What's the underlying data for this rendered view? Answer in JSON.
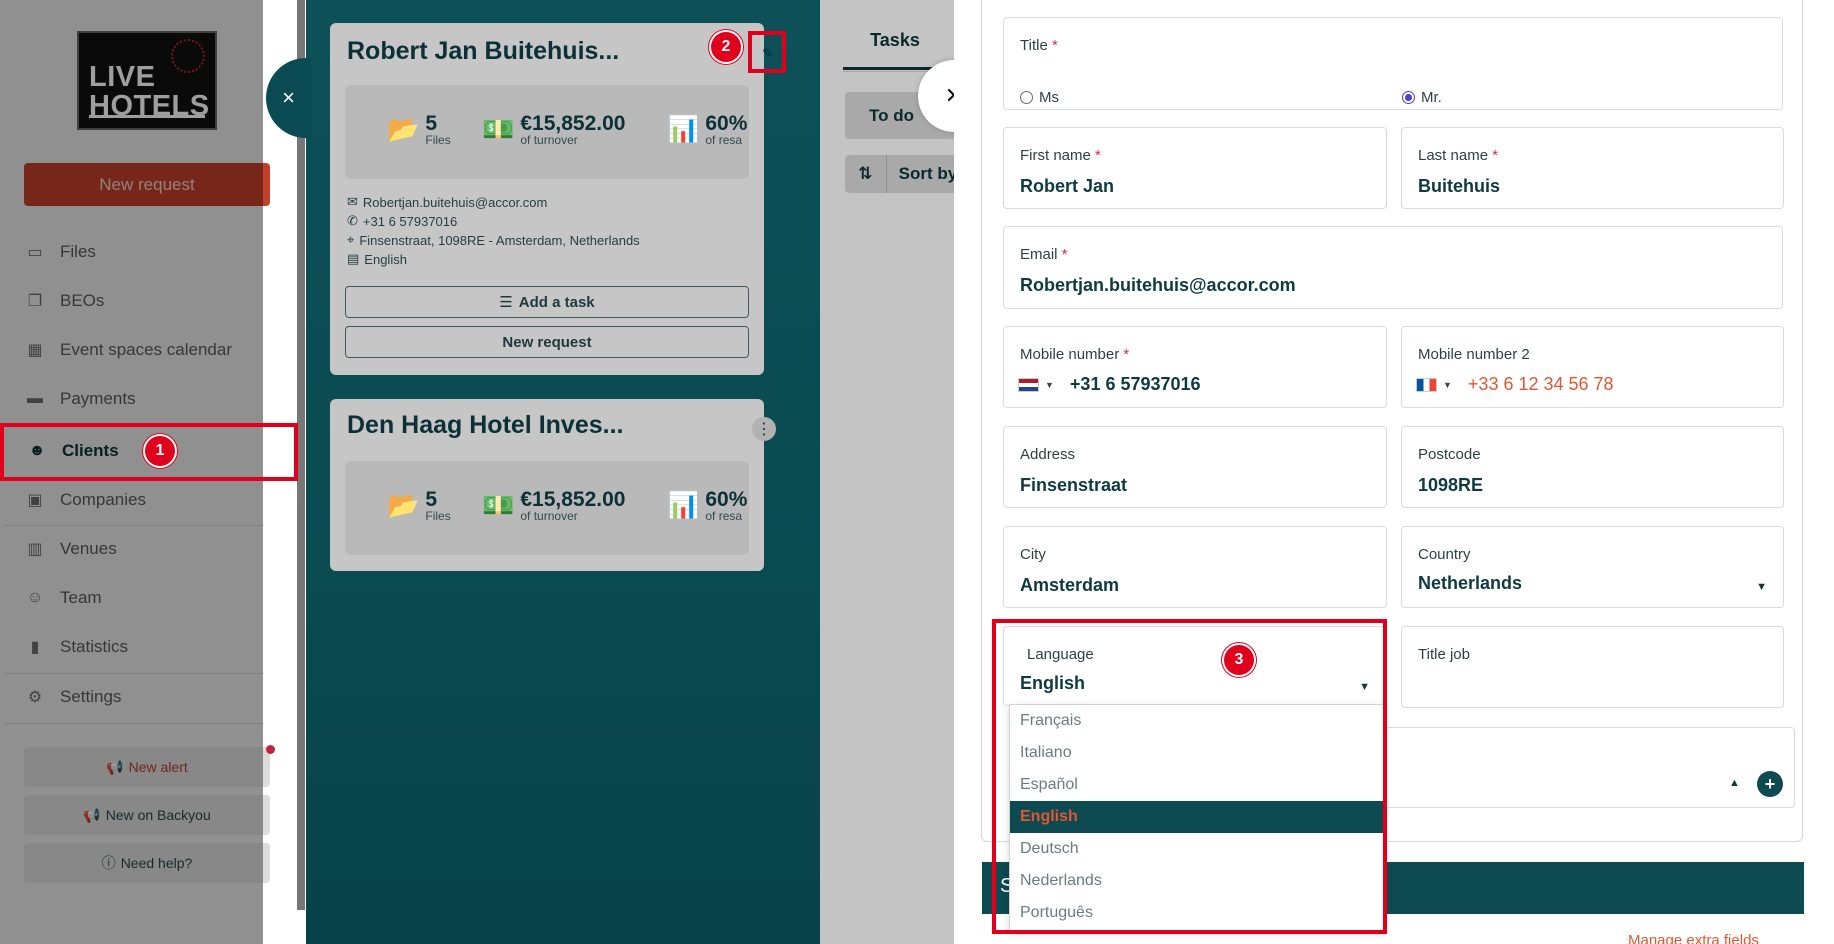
{
  "sidebar": {
    "logo": {
      "line1": "LIVE",
      "line2": "HOTELS"
    },
    "new_request": "New request",
    "nav": [
      {
        "label": "Files",
        "icon": "folder-icon"
      },
      {
        "label": "BEOs",
        "icon": "documents-icon"
      },
      {
        "label": "Event spaces calendar",
        "icon": "calendar-icon"
      },
      {
        "label": "Payments",
        "icon": "credit-card-icon"
      },
      {
        "label": "Clients",
        "icon": "users-icon",
        "active": true
      },
      {
        "label": "Companies",
        "icon": "briefcase-icon"
      },
      {
        "label": "Venues",
        "icon": "building-icon"
      },
      {
        "label": "Team",
        "icon": "team-icon"
      },
      {
        "label": "Statistics",
        "icon": "bar-chart-icon"
      },
      {
        "label": "Settings",
        "icon": "gear-icon"
      }
    ],
    "new_alert": "New alert",
    "new_on": "New on Backyou",
    "need_help": "Need help?"
  },
  "clients": [
    {
      "name": "Robert Jan Buitehuis...",
      "files": "5",
      "files_label": "Files",
      "turnover": "€15,852.00",
      "turnover_label": "of turnover",
      "resa": "60%",
      "resa_label": "of resa",
      "email": "Robertjan.buitehuis@accor.com",
      "phone": "+31 6 57937016",
      "address": "Finsenstraat, 1098RE - Amsterdam, Netherlands",
      "language": "English",
      "add_task": "Add a task",
      "new_request": "New request"
    },
    {
      "name": "Den Haag Hotel Inves...",
      "files": "5",
      "files_label": "Files",
      "turnover": "€15,852.00",
      "turnover_label": "of turnover",
      "resa": "60%",
      "resa_label": "of resa"
    }
  ],
  "tasks": {
    "tab": "Tasks",
    "todo": "To do",
    "sort": "Sort by"
  },
  "form": {
    "title": {
      "label": "Title",
      "options": [
        "Ms",
        "Mr."
      ],
      "selected": "Mr."
    },
    "first_name": {
      "label": "First name",
      "value": "Robert Jan"
    },
    "last_name": {
      "label": "Last name",
      "value": "Buitehuis"
    },
    "email": {
      "label": "Email",
      "value": "Robertjan.buitehuis@accor.com"
    },
    "mobile": {
      "label": "Mobile number",
      "value": "+31 6 57937016"
    },
    "mobile2": {
      "label": "Mobile number 2",
      "value": "+33 6 12 34 56 78"
    },
    "address": {
      "label": "Address",
      "value": "Finsenstraat"
    },
    "postcode": {
      "label": "Postcode",
      "value": "1098RE"
    },
    "city": {
      "label": "City",
      "value": "Amsterdam"
    },
    "country": {
      "label": "Country",
      "value": "Netherlands"
    },
    "language": {
      "label": "Language",
      "value": "English",
      "options": [
        "Français",
        "Italiano",
        "Español",
        "English",
        "Deutsch",
        "Nederlands",
        "Português"
      ]
    },
    "title_job": {
      "label": "Title job"
    },
    "section_letter": "S",
    "more_link": "Manage extra fields"
  },
  "annotations": [
    "1",
    "2",
    "3"
  ],
  "colors": {
    "accent_teal": "#0d4a52",
    "accent_orange": "#e4572e",
    "annotation_red": "#e0001b"
  }
}
